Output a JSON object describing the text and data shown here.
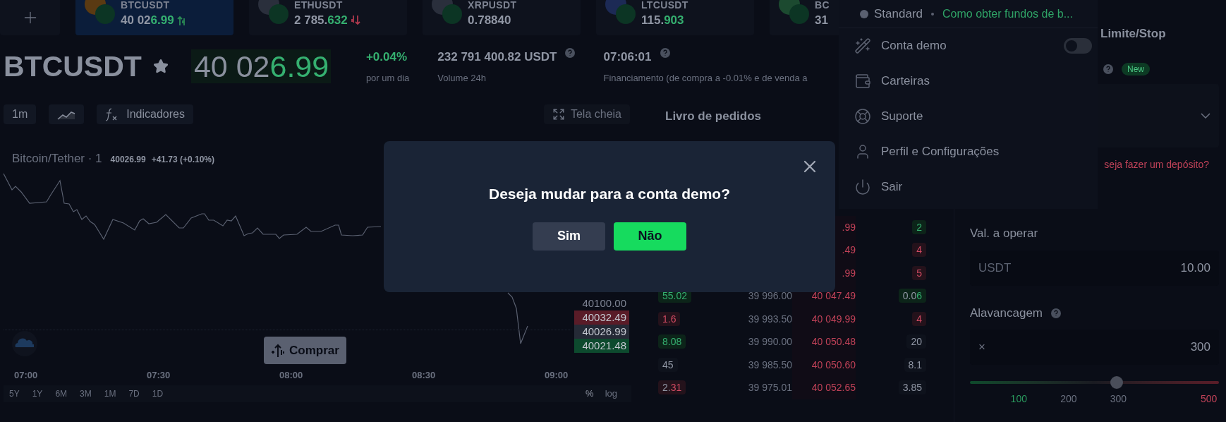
{
  "tickers": [
    {
      "symbol": "BTCUSDT",
      "price": "40 02",
      "price_accent": "6.99",
      "kind": "rising",
      "color": "#5a3a12",
      "selected": true
    },
    {
      "symbol": "ETHUSDT",
      "price": "2 785.",
      "price_accent": "632",
      "kind": "falling",
      "color": "#2a2f3c",
      "selected": false
    },
    {
      "symbol": "XRPUSDT",
      "price": "0.78840",
      "kind": "flat",
      "color": "#2a2f3c",
      "selected": false
    },
    {
      "symbol": "LTCUSDT",
      "price": "115.",
      "price_accent": "903",
      "kind": "flat",
      "color": "#1c2a55",
      "selected": false
    },
    {
      "symbol": "BC",
      "price": "31",
      "kind": "flat",
      "color": "#1c4a30",
      "selected": false
    }
  ],
  "instrument": {
    "symbol": "BTCUSDT",
    "price": "40 02",
    "price_accent": "6.99"
  },
  "stats": [
    {
      "value": "+0.04%",
      "label": "por um dia",
      "kind": "change",
      "help": false
    },
    {
      "value": "232 791 400.82 USDT",
      "label": "Volume 24h",
      "kind": "plain",
      "help": true
    },
    {
      "value": "07:06:01",
      "label": "Financiamento (de compra a -0.01% e de venda a",
      "kind": "plain",
      "help": true
    }
  ],
  "chart_toolbar": {
    "interval": "1m",
    "indicators": "Indicadores",
    "fullscreen": "Tela cheia"
  },
  "chart": {
    "legend_title": "Bitcoin/Tether · 1",
    "legend_price": "40026.99",
    "legend_change": "+41.73 (+0.10%)",
    "price_tags": [
      {
        "text": "40100.00",
        "kind": "plain"
      },
      {
        "text": "40032.49",
        "kind": "sell"
      },
      {
        "text": "40026.99",
        "kind": "last"
      },
      {
        "text": "40021.48",
        "kind": "buy"
      }
    ],
    "buy_button": "Comprar",
    "time_labels": [
      "07:00",
      "07:30",
      "08:00",
      "08:30",
      "09:00"
    ],
    "ranges": [
      "5Y",
      "1Y",
      "6M",
      "3M",
      "1M",
      "7D",
      "1D"
    ],
    "scale_options": [
      "%",
      "log"
    ]
  },
  "order_book": {
    "title": "Livro de pedidos",
    "rows": [
      {
        "ask_price": ".99",
        "ask_size": {
          "accent": "2",
          "kind": "buy"
        }
      },
      {
        "ask_price": ".49",
        "ask_size": {
          "accent": "4",
          "kind": "sell"
        }
      },
      {
        "ask_price": ".99",
        "ask_size": {
          "accent": "5",
          "kind": "sell"
        }
      },
      {
        "bid_size": {
          "accent": "55.02",
          "kind": "buy"
        },
        "bid_price": "39 996.00",
        "ask_price": "40 047.49",
        "ask_size": {
          "text": "0.0",
          "accent": "6",
          "kind": "buy"
        }
      },
      {
        "bid_size": {
          "accent": "1.6",
          "kind": "sell"
        },
        "bid_price": "39 993.50",
        "ask_price": "40 049.99",
        "ask_size": {
          "accent": "4",
          "kind": "sell"
        }
      },
      {
        "bid_size": {
          "accent": "8.08",
          "kind": "buy"
        },
        "bid_price": "39 990.00",
        "ask_price": "40 050.48",
        "ask_size": {
          "text": "20",
          "kind": "plain"
        }
      },
      {
        "bid_size": {
          "text": "45",
          "kind": "plain"
        },
        "bid_price": "39 985.50",
        "ask_price": "40 050.60",
        "ask_size": {
          "text": "8.1",
          "kind": "plain"
        }
      },
      {
        "bid_size": {
          "text": "2.",
          "accent": "31",
          "kind": "sell"
        },
        "bid_price": "39 975.01",
        "ask_price": "40 052.65",
        "ask_size": {
          "text": "3.85",
          "kind": "plain"
        }
      }
    ]
  },
  "account_menu": {
    "plan": "Standard",
    "funding_link": "Como obter fundos de b...",
    "items": [
      {
        "label": "Conta demo",
        "kind": "toggle",
        "on": false
      },
      {
        "label": "Carteiras",
        "kind": "link"
      },
      {
        "label": "Suporte",
        "kind": "link"
      },
      {
        "label": "Perfil e Configurações",
        "kind": "link"
      },
      {
        "label": "Sair",
        "kind": "link"
      }
    ]
  },
  "trade_panel": {
    "order_tab": "Limite/Stop",
    "new_badge": "New",
    "deposit_prompt": "seja fazer um depósito?",
    "amount": {
      "label": "Val. a operar",
      "currency": "USDT",
      "value": "10.00"
    },
    "leverage": {
      "label": "Alavancagem",
      "prefix": "×",
      "value": "300",
      "level": 0.59,
      "marks": [
        {
          "text": "100",
          "kind": "buy"
        },
        {
          "text": "200",
          "kind": "plain"
        },
        {
          "text": "300",
          "kind": "plain"
        },
        {
          "text": "500",
          "kind": "sell"
        }
      ]
    }
  },
  "modal": {
    "question": "Deseja mudar para a conta demo?",
    "confirm": "Sim",
    "cancel": "Não"
  }
}
